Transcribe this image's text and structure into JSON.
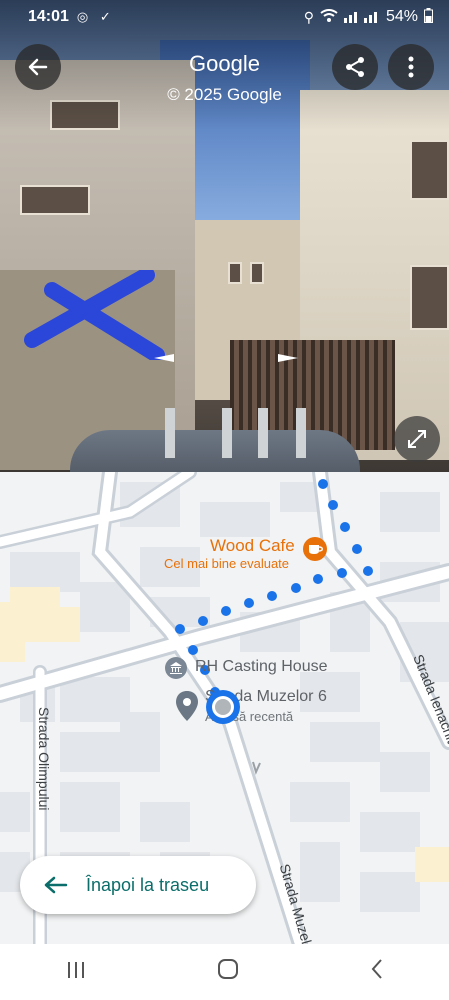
{
  "status_bar": {
    "time": "14:01",
    "battery": "54%"
  },
  "street_view": {
    "title": "Google",
    "copyright": "© 2025 Google"
  },
  "map": {
    "poi_cafe_name": "Wood Cafe",
    "poi_cafe_subtitle": "Cel mai bine evaluate",
    "poi_casting": "RH Casting House",
    "destination_name": "Strada Muzelor 6",
    "destination_subtitle": "Adresă recentă",
    "street_olimpului": "Strada Olimpului",
    "street_ienachita": "Strada Ienachita",
    "street_muzelor": "Strada Muzelor"
  },
  "back_to_route_label": "Înapoi la traseu",
  "colors": {
    "route_blue": "#1a73e8",
    "cafe_orange": "#e8710a",
    "teal": "#0b6e6a"
  }
}
